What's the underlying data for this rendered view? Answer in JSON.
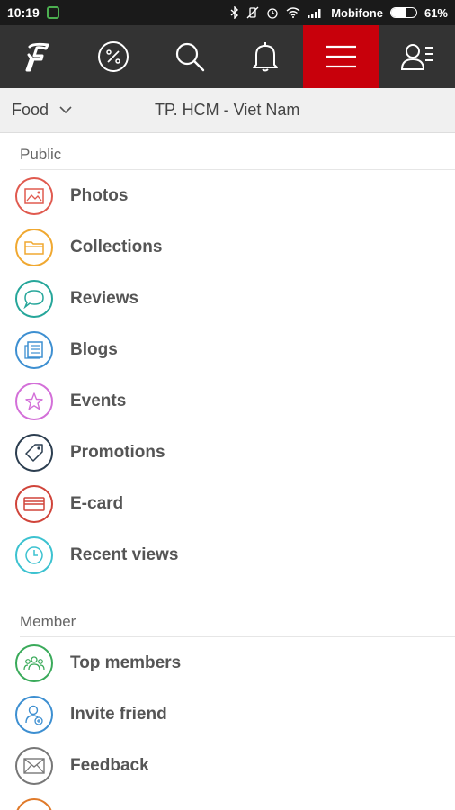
{
  "statusbar": {
    "time": "10:19",
    "carrier": "Mobifone",
    "battery": "61%",
    "battery_level": 0.61
  },
  "navbar": {
    "items": [
      {
        "name": "logo",
        "icon": "foody-f-logo"
      },
      {
        "name": "promotions",
        "icon": "percent-icon"
      },
      {
        "name": "search",
        "icon": "search-icon"
      },
      {
        "name": "notifications",
        "icon": "bell-icon"
      },
      {
        "name": "menu",
        "icon": "hamburger-menu-icon",
        "active": true
      },
      {
        "name": "account",
        "icon": "user-list-icon"
      }
    ],
    "active_color": "#c8000b",
    "bg_color": "#333333"
  },
  "filter": {
    "category": "Food",
    "location": "TP. HCM - Viet Nam"
  },
  "sections": {
    "public": {
      "title": "Public",
      "items": [
        {
          "label": "Photos",
          "icon": "photo-icon",
          "color": "#e05a4f"
        },
        {
          "label": "Collections",
          "icon": "folder-icon",
          "color": "#f0a830"
        },
        {
          "label": "Reviews",
          "icon": "speech-bubble-icon",
          "color": "#26a69a"
        },
        {
          "label": "Blogs",
          "icon": "newspaper-icon",
          "color": "#3d8fd1"
        },
        {
          "label": "Events",
          "icon": "star-icon",
          "color": "#d36fd8"
        },
        {
          "label": "Promotions",
          "icon": "tag-icon",
          "color": "#2c3e50"
        },
        {
          "label": "E-card",
          "icon": "card-icon",
          "color": "#d0443a"
        },
        {
          "label": "Recent views",
          "icon": "clock-icon",
          "color": "#3cc2d0"
        }
      ]
    },
    "member": {
      "title": "Member",
      "items": [
        {
          "label": "Top members",
          "icon": "group-icon",
          "color": "#3aaa5a"
        },
        {
          "label": "Invite friend",
          "icon": "add-user-icon",
          "color": "#3d8fd1"
        },
        {
          "label": "Feedback",
          "icon": "envelope-icon",
          "color": "#777777"
        },
        {
          "label": "",
          "icon": "partial-icon",
          "color": "#e07a2a"
        }
      ]
    }
  }
}
